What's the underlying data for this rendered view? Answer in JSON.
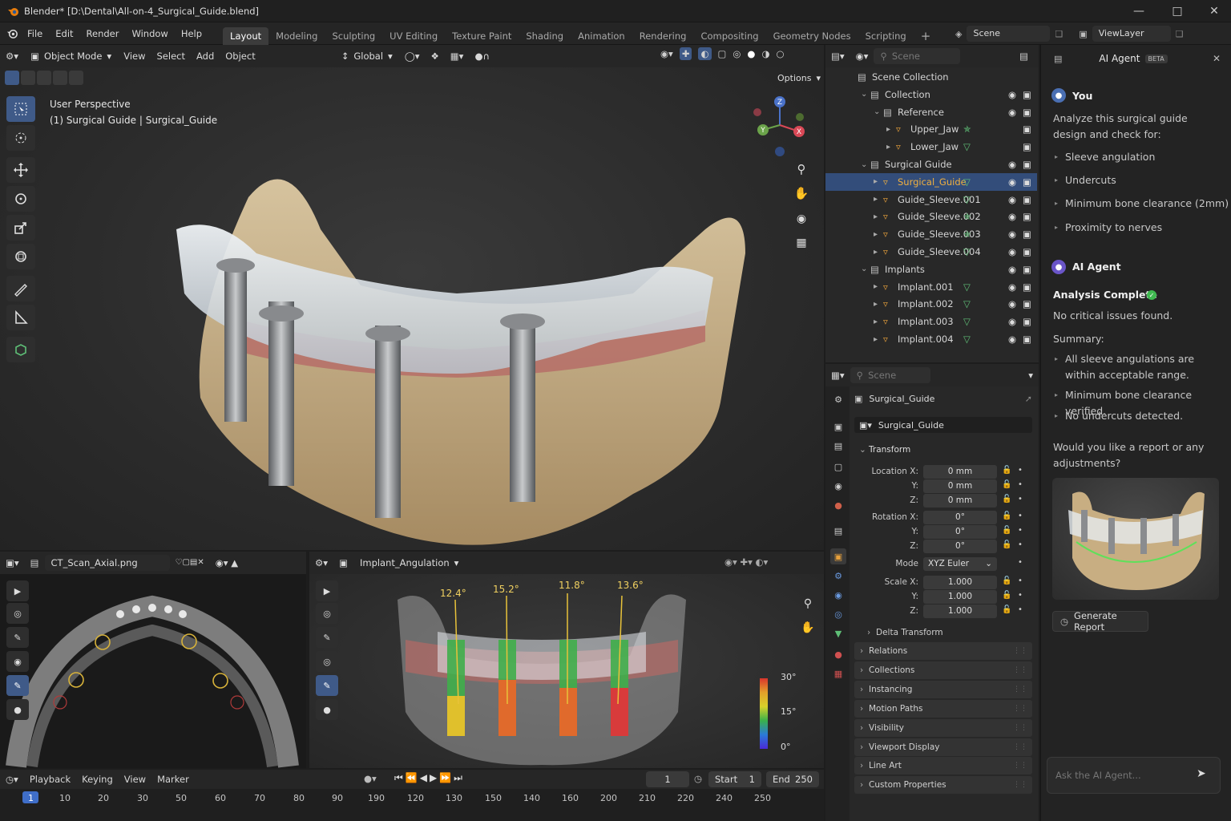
{
  "window": {
    "title": "Blender* [D:\\Dental\\All-on-4_Surgical_Guide.blend]"
  },
  "menu": [
    "File",
    "Edit",
    "Render",
    "Window",
    "Help"
  ],
  "workspaces": [
    "Layout",
    "Modeling",
    "Sculpting",
    "UV Editing",
    "Texture Paint",
    "Shading",
    "Animation",
    "Rendering",
    "Compositing",
    "Geometry Nodes",
    "Scripting"
  ],
  "scene": {
    "label": "Scene",
    "viewlayer": "ViewLayer"
  },
  "viewport": {
    "mode": "Object Mode",
    "menus": [
      "View",
      "Select",
      "Add",
      "Object"
    ],
    "orientation": "Global",
    "options": "Options",
    "overlay_line1": "User Perspective",
    "overlay_line2": "(1) Surgical Guide | Surgical_Guide"
  },
  "image_editor": {
    "image_name": "CT_Scan_Axial.png"
  },
  "angulation_view": {
    "view_name": "Implant_Angulation",
    "angles": [
      "12.4°",
      "15.2°",
      "11.8°",
      "13.6°"
    ],
    "scale": [
      "30°",
      "15°",
      "0°"
    ]
  },
  "outliner": {
    "search_placeholder": "Scene",
    "rows": [
      {
        "name": "Scene Collection",
        "kind": "scene",
        "indent": 0
      },
      {
        "name": "Collection",
        "kind": "collection",
        "indent": 1
      },
      {
        "name": "Reference",
        "kind": "collection",
        "indent": 2
      },
      {
        "name": "Upper_Jaw",
        "kind": "object",
        "indent": 3
      },
      {
        "name": "Lower_Jaw",
        "kind": "object",
        "indent": 3
      },
      {
        "name": "Surgical Guide",
        "kind": "collection",
        "indent": 1
      },
      {
        "name": "Surgical_Guide",
        "kind": "object",
        "indent": 2,
        "selected": true
      },
      {
        "name": "Guide_Sleeve.001",
        "kind": "object",
        "indent": 2
      },
      {
        "name": "Guide_Sleeve.002",
        "kind": "object",
        "indent": 2
      },
      {
        "name": "Guide_Sleeve.003",
        "kind": "object",
        "indent": 2
      },
      {
        "name": "Guide_Sleeve.004",
        "kind": "object",
        "indent": 2
      },
      {
        "name": "Implants",
        "kind": "collection",
        "indent": 1
      },
      {
        "name": "Implant.001",
        "kind": "object",
        "indent": 2
      },
      {
        "name": "Implant.002",
        "kind": "object",
        "indent": 2
      },
      {
        "name": "Implant.003",
        "kind": "object",
        "indent": 2
      },
      {
        "name": "Implant.004",
        "kind": "object",
        "indent": 2
      }
    ]
  },
  "properties": {
    "search_placeholder": "Scene",
    "object_name": "Surgical_Guide",
    "data_name": "Surgical_Guide",
    "transform_label": "Transform",
    "location": {
      "label": "Location X:",
      "x": "0 mm",
      "y": "0 mm",
      "z": "0 mm"
    },
    "rotation": {
      "label": "Rotation X:",
      "x": "0°",
      "y": "0°",
      "z": "0°"
    },
    "mode_label": "Mode",
    "mode_value": "XYZ Euler",
    "scale": {
      "label": "Scale X:",
      "x": "1.000",
      "y": "1.000",
      "z": "1.000"
    },
    "axis_y": "Y:",
    "axis_z": "Z:",
    "delta": "Delta Transform",
    "sections": [
      "Relations",
      "Collections",
      "Instancing",
      "Motion Paths",
      "Visibility",
      "Viewport Display",
      "Line Art",
      "Custom Properties"
    ]
  },
  "timeline": {
    "menus": [
      "Playback",
      "Keying",
      "View",
      "Marker"
    ],
    "current_frame": "1",
    "start_label": "Start",
    "start": "1",
    "end_label": "End",
    "end": "250",
    "ticks": [
      "1",
      "10",
      "20",
      "30",
      "50",
      "60",
      "70",
      "80",
      "90",
      "190",
      "120",
      "130",
      "150",
      "140",
      "160",
      "200",
      "210",
      "220",
      "240",
      "250"
    ]
  },
  "ai_panel": {
    "title": "AI Agent",
    "badge": "BETA",
    "user_name": "You",
    "user_msg": "Analyze this surgical guide design and check for:",
    "user_bullets": [
      "Sleeve angulation",
      "Undercuts",
      "Minimum bone clearance (2mm)",
      "Proximity to nerves"
    ],
    "agent_name": "AI Agent",
    "status": "Analysis Complete",
    "no_issues": "No critical issues found.",
    "summary_label": "Summary:",
    "summary": [
      "All sleeve angulations are within acceptable range.",
      "Minimum bone clearance verified.",
      "No undercuts detected."
    ],
    "question": "Would you like a report or any adjustments?",
    "report_button": "Generate Report",
    "input_placeholder": "Ask the AI Agent..."
  },
  "colors": {
    "accent": "#4772b3",
    "selected": "#334d7a",
    "success": "#3fb950",
    "object_orange": "#e8a13c",
    "vertex_green": "#5fbf77"
  }
}
